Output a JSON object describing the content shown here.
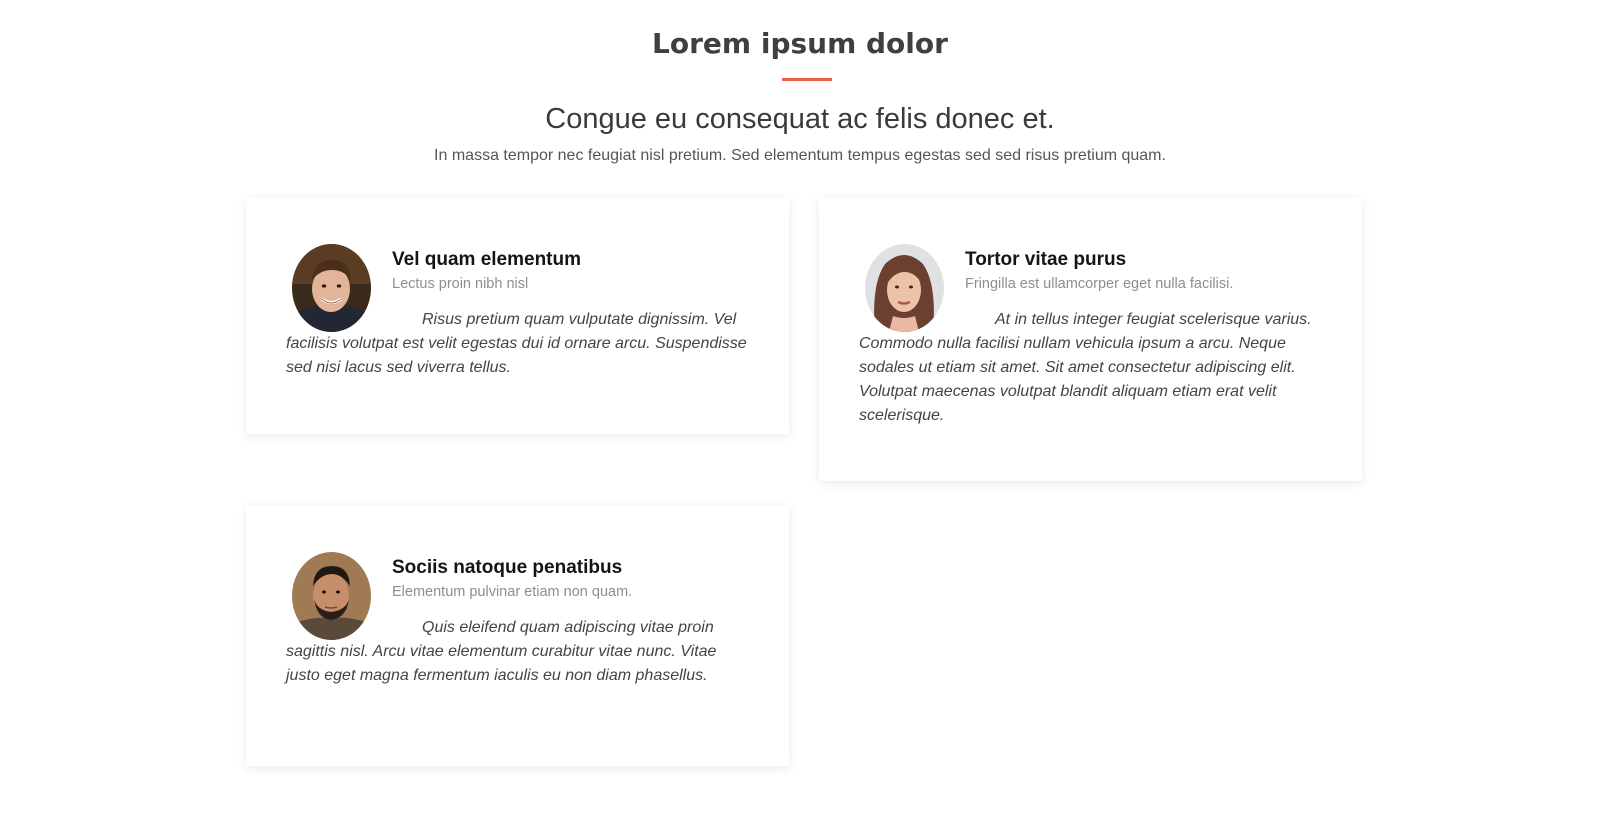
{
  "section": {
    "title": "Lorem ipsum dolor",
    "subtitle": "Congue eu consequat ac felis donec et.",
    "description": "In massa tempor nec feugiat nisl pretium. Sed elementum tempus egestas sed sed risus pretium quam."
  },
  "colors": {
    "accent": "#e8604c",
    "heading": "#151515",
    "muted": "#8e8e8e"
  },
  "testimonials": [
    {
      "name": "Vel quam elementum",
      "role": "Lectus proin nibh nisl",
      "quote": "Risus pretium quam vulputate dignissim. Vel facilisis volutpat est velit egestas dui id ornare arcu. Suspendisse sed nisi lacus sed viverra tellus.",
      "avatar": "man-portrait"
    },
    {
      "name": "Tortor vitae purus",
      "role": "Fringilla est ullamcorper eget nulla facilisi.",
      "quote": "At in tellus integer feugiat scelerisque varius. Commodo nulla facilisi nullam vehicula ipsum a arcu. Neque sodales ut etiam sit amet. Sit amet consectetur adipiscing elit. Volutpat maecenas volutpat blandit aliquam etiam erat velit scelerisque.",
      "avatar": "woman-portrait"
    },
    {
      "name": "Sociis natoque penatibus",
      "role": "Elementum pulvinar etiam non quam.",
      "quote": "Quis eleifend quam adipiscing vitae proin sagittis nisl. Arcu vitae elementum curabitur vitae nunc. Vitae justo eget magna fermentum iaculis eu non diam phasellus.",
      "avatar": "bearded-man-portrait"
    }
  ]
}
